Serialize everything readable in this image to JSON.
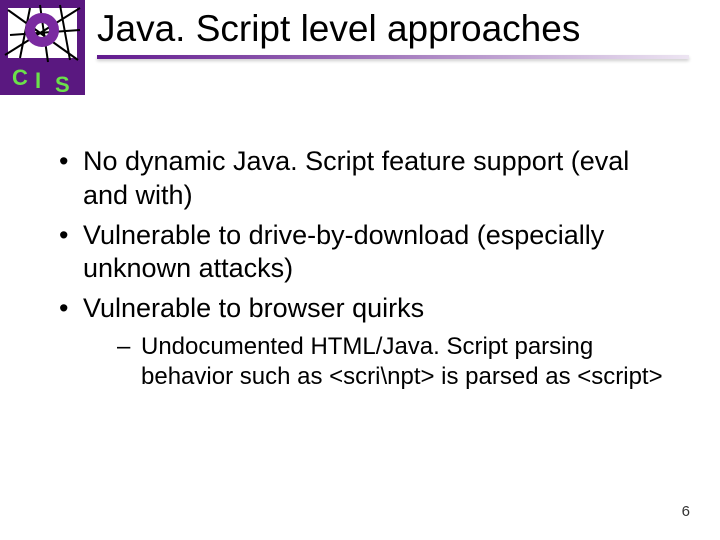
{
  "title": "Java. Script level approaches",
  "bullets": [
    "No dynamic Java. Script feature support (eval and with)",
    "Vulnerable to drive-by-download (especially unknown attacks)",
    "Vulnerable to browser quirks"
  ],
  "sub_bullet": "Undocumented HTML/Java. Script parsing behavior such as <scri\\npt> is parsed as <script>",
  "page_number": "6"
}
